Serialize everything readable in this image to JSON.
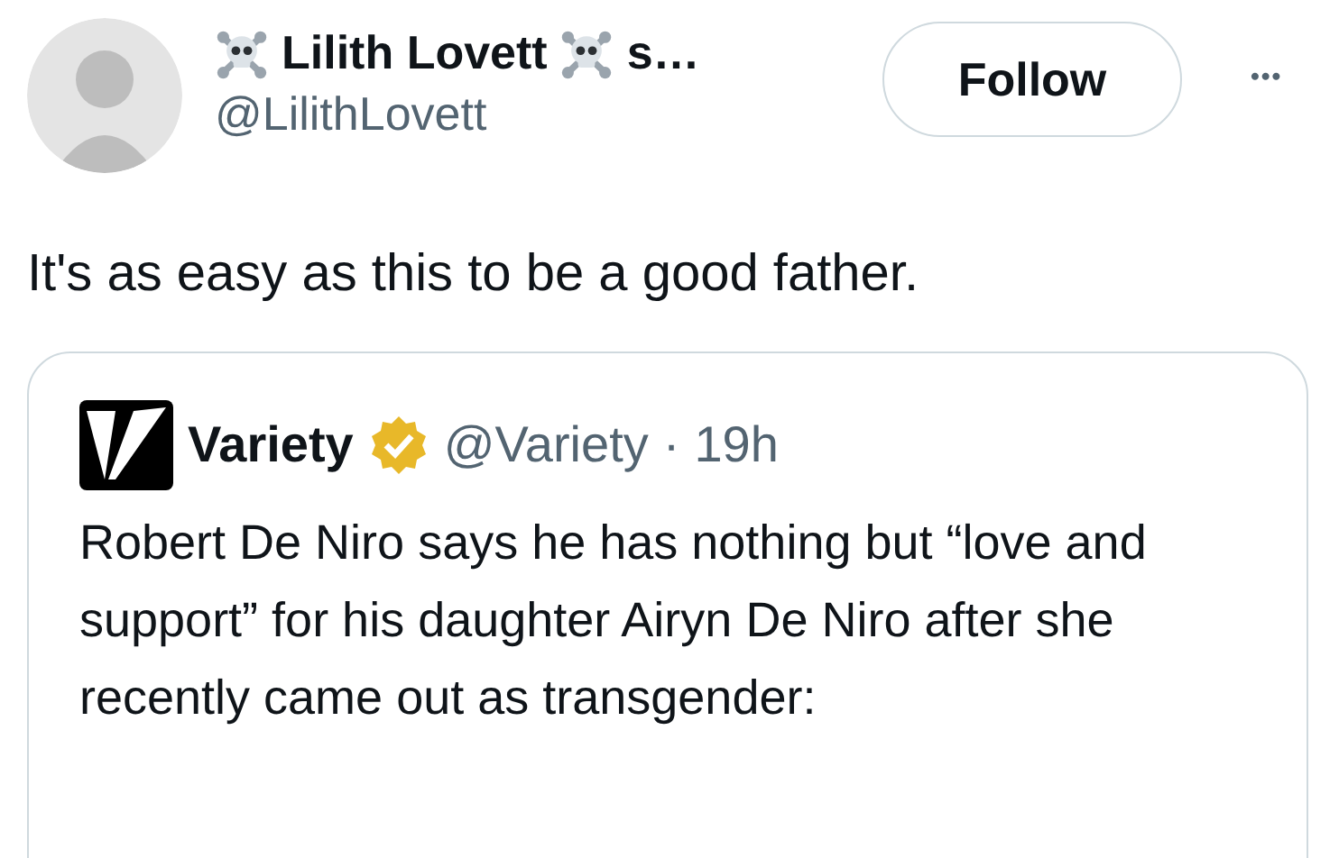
{
  "author": {
    "name": "Lilith Lovett",
    "name_tail": "s…",
    "handle": "@LilithLovett"
  },
  "follow_button": "Follow",
  "more_button": "•••",
  "text": "It's as easy as this to be a good father.",
  "quoted_tweet": {
    "name": "Variety",
    "verified": true,
    "handle": "@Variety",
    "separator": "·",
    "time": "19h",
    "text": "Robert De Niro says he has nothing but “love and support” for his daughter Airyn De Niro after she recently came out as transgender:"
  }
}
